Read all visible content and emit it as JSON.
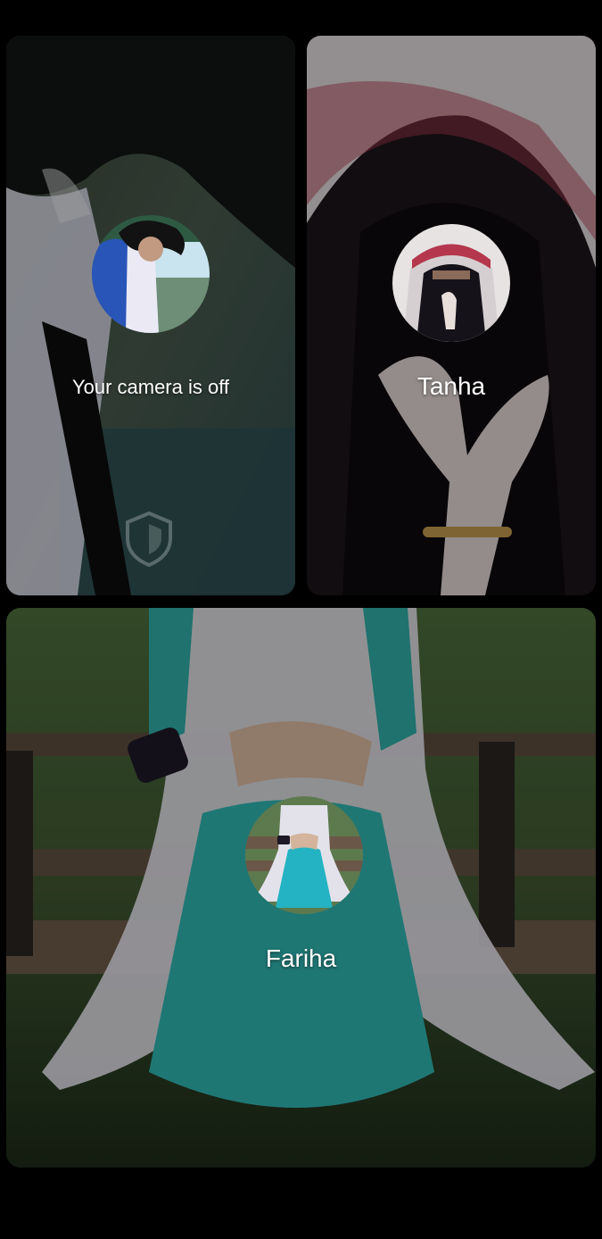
{
  "call": {
    "tiles": [
      {
        "id": "self",
        "label": "Your camera is off",
        "camera_on": false,
        "avatar_icon": "profile-photo",
        "overlay_icon": "shield-icon"
      },
      {
        "id": "tanha",
        "label": "Tanha",
        "avatar_icon": "profile-photo"
      },
      {
        "id": "fariha",
        "label": "Fariha",
        "avatar_icon": "profile-photo"
      }
    ]
  },
  "colors": {
    "background": "#000000",
    "label_text": "#ffffff"
  }
}
